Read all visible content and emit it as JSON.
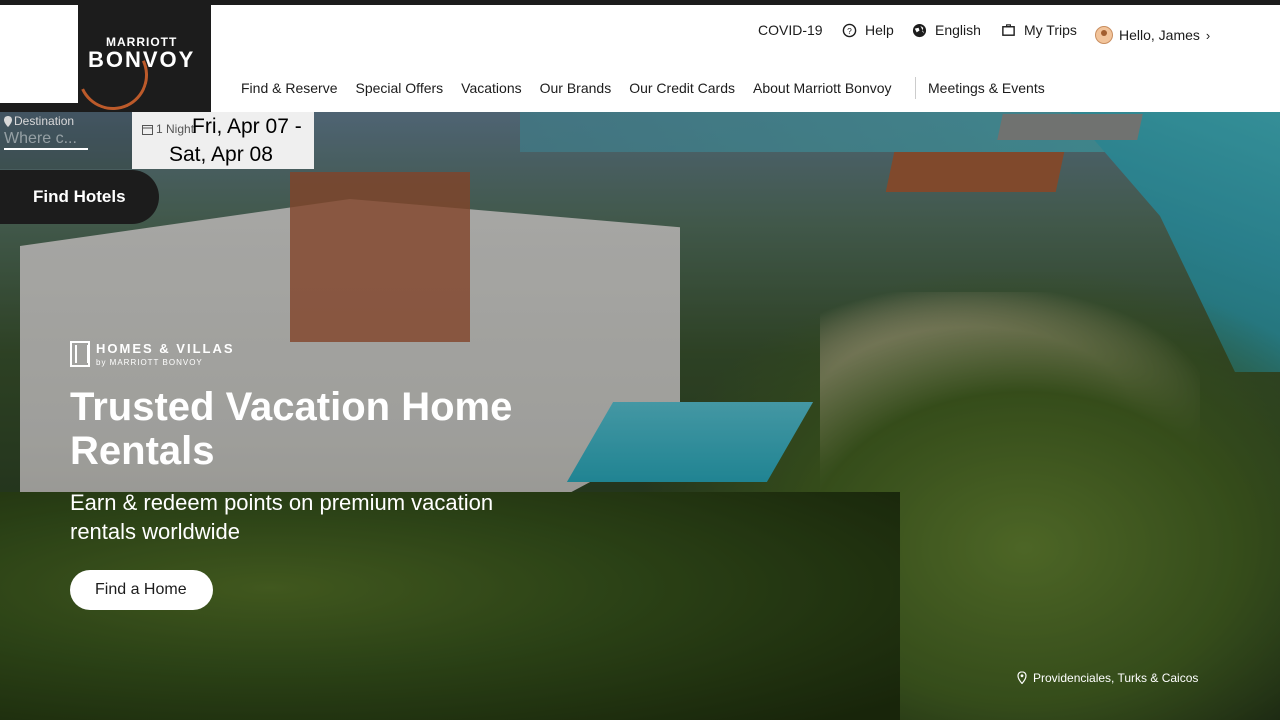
{
  "utility_nav": {
    "covid": "COVID-19",
    "help": "Help",
    "language": "English",
    "trips": "My Trips",
    "greeting": "Hello, James"
  },
  "brand": {
    "line1": "MARRIOTT",
    "line2": "BONVOY"
  },
  "main_nav": {
    "items": [
      "Find & Reserve",
      "Special Offers",
      "Vacations",
      "Our Brands",
      "Our Credit Cards",
      "About Marriott Bonvoy"
    ],
    "meetings": "Meetings & Events"
  },
  "search": {
    "destination_label": "Destination",
    "destination_placeholder": "Where c...",
    "nights": "1 Night",
    "check_in": "Fri, Apr 07 -",
    "check_out": "Sat, Apr 08",
    "find_hotels": "Find Hotels"
  },
  "hero": {
    "brand_line1": "HOMES & VILLAS",
    "brand_line2": "by MARRIOTT BONVOY",
    "title": "Trusted Vacation Home Rentals",
    "subtitle": "Earn & redeem points on premium vacation rentals worldwide",
    "cta": "Find a Home",
    "location": "Providenciales, Turks & Caicos"
  },
  "colors": {
    "dark": "#1c1c1c",
    "accent": "#e56a2e",
    "white": "#ffffff"
  }
}
